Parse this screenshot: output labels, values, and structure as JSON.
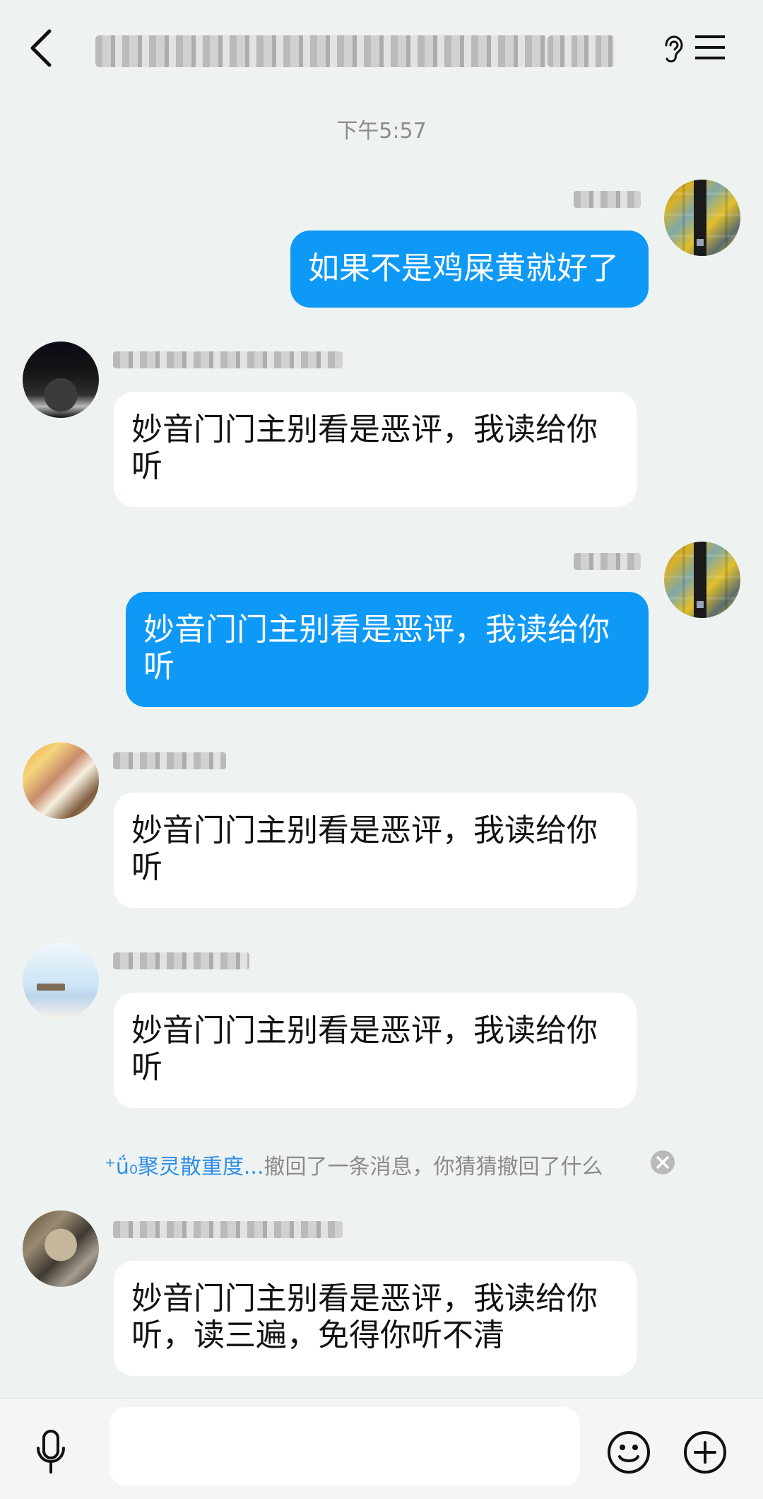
{
  "header": {
    "title_text": "",
    "back_icon": "back-chevron-icon",
    "ear_icon": "ear-icon",
    "menu_icon": "menu-icon"
  },
  "time_label": "下午5:57",
  "messages": [
    {
      "id": "msg-1",
      "side": "self",
      "text": "如果不是鸡屎黄就好了",
      "avatar": "pixelated-avatar",
      "sender_name_visible": false
    },
    {
      "id": "msg-2",
      "side": "other",
      "text": "妙音门门主别看是恶评，我读给你听",
      "avatar": "pixelated-avatar",
      "sender_name_visible": false
    },
    {
      "id": "msg-3",
      "side": "self",
      "text": "妙音门门主别看是恶评，我读给你听",
      "avatar": "pixelated-avatar",
      "sender_name_visible": false
    },
    {
      "id": "msg-4",
      "side": "other",
      "text": "妙音门门主别看是恶评，我读给你听",
      "avatar": "pixelated-avatar",
      "sender_name_visible": false
    },
    {
      "id": "msg-5",
      "side": "other",
      "text": "妙音门门主别看是恶评，我读给你听",
      "avatar": "pixelated-avatar",
      "sender_name_visible": false
    },
    {
      "id": "msg-6",
      "side": "other",
      "text": "妙音门门主别看是恶评，我读给你听，读三遍，免得你听不清",
      "avatar": "pixelated-avatar",
      "sender_name_visible": false
    }
  ],
  "recall_notice": {
    "name": "⁺ǘ₀聚灵散重度...",
    "text": "撤回了一条消息，你猜猜撤回了什么",
    "close_icon": "close-icon"
  },
  "input_bar": {
    "mic_icon": "microphone-icon",
    "input_value": "",
    "input_placeholder": "",
    "emoji_icon": "emoji-icon",
    "plus_icon": "add-icon"
  },
  "colors": {
    "background": "#eef2f0",
    "self_bubble": "#0f99f7",
    "other_bubble": "#ffffff",
    "recall_name": "#2f8fe8"
  }
}
